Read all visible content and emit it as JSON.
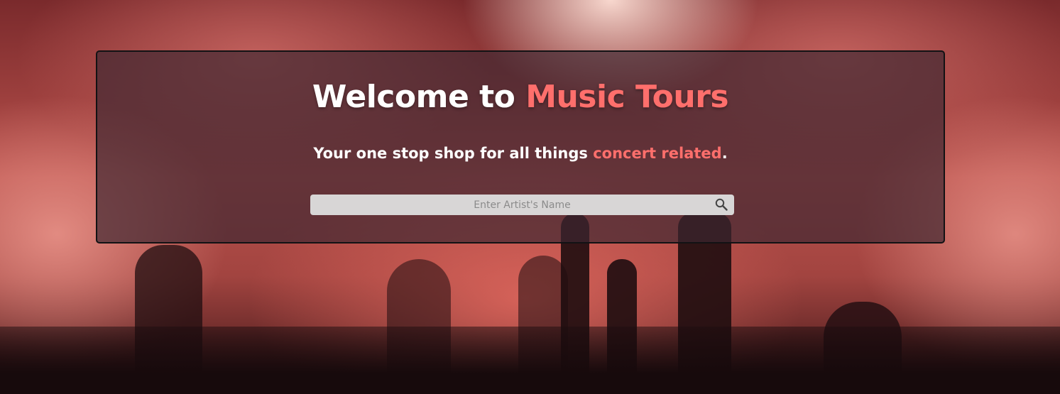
{
  "hero": {
    "title_prefix": "Welcome to ",
    "title_accent": "Music Tours",
    "subtitle_prefix": "Your one stop shop for all things ",
    "subtitle_accent": "concert related",
    "subtitle_suffix": "."
  },
  "search": {
    "placeholder": "Enter Artist's Name",
    "value": "",
    "icon": "search-icon"
  },
  "colors": {
    "accent": "#ff6f6c",
    "panel": "#3c2630",
    "search_bg": "#d8d6d6"
  }
}
